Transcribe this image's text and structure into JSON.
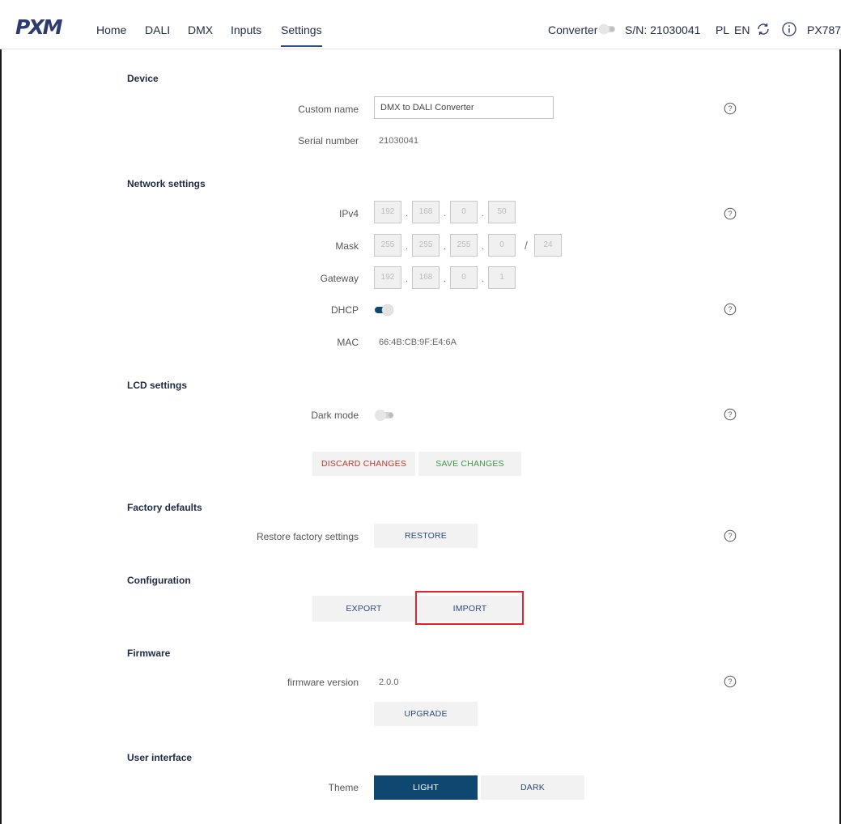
{
  "header": {
    "logo": "PXM",
    "nav": [
      "Home",
      "DALI",
      "DMX",
      "Inputs",
      "Settings"
    ],
    "active_nav": "Settings",
    "converter_label": "Converter",
    "serial": "S/N: 21030041",
    "lang_pl": "PL",
    "lang_en": "EN",
    "model": "PX787"
  },
  "device": {
    "title": "Device",
    "custom_name_label": "Custom name",
    "custom_name_value": "DMX to DALI Converter",
    "serial_label": "Serial number",
    "serial_value": "21030041"
  },
  "network": {
    "title": "Network settings",
    "ipv4_label": "IPv4",
    "ipv4": [
      "192",
      "168",
      "0",
      "50"
    ],
    "mask_label": "Mask",
    "mask": [
      "255",
      "255",
      "255",
      "0"
    ],
    "mask_prefix": "24",
    "gateway_label": "Gateway",
    "gateway": [
      "192",
      "168",
      "0",
      "1"
    ],
    "dhcp_label": "DHCP",
    "dhcp_enabled": true,
    "mac_label": "MAC",
    "mac_value": "66:4B:CB:9F:E4:6A"
  },
  "lcd": {
    "title": "LCD settings",
    "dark_mode_label": "Dark mode",
    "dark_mode_enabled": false
  },
  "actions": {
    "discard_label": "DISCARD CHANGES",
    "save_label": "SAVE CHANGES"
  },
  "factory": {
    "title": "Factory defaults",
    "restore_label": "Restore factory settings",
    "restore_button": "RESTORE"
  },
  "configuration": {
    "title": "Configuration",
    "export_button": "EXPORT",
    "import_button": "IMPORT"
  },
  "firmware": {
    "title": "Firmware",
    "version_label": "firmware version",
    "version_value": "2.0.0",
    "upgrade_button": "UPGRADE"
  },
  "ui": {
    "title": "User interface",
    "theme_label": "Theme",
    "light_button": "LIGHT",
    "dark_button": "DARK",
    "selected_theme": "LIGHT"
  },
  "colors": {
    "accent": "#0e4770",
    "discard": "#c0392b",
    "save": "#3a9a44",
    "highlight": "#e0242b"
  },
  "icons": [
    "refresh-icon",
    "info-icon",
    "help-icon",
    "toggle-switch"
  ]
}
